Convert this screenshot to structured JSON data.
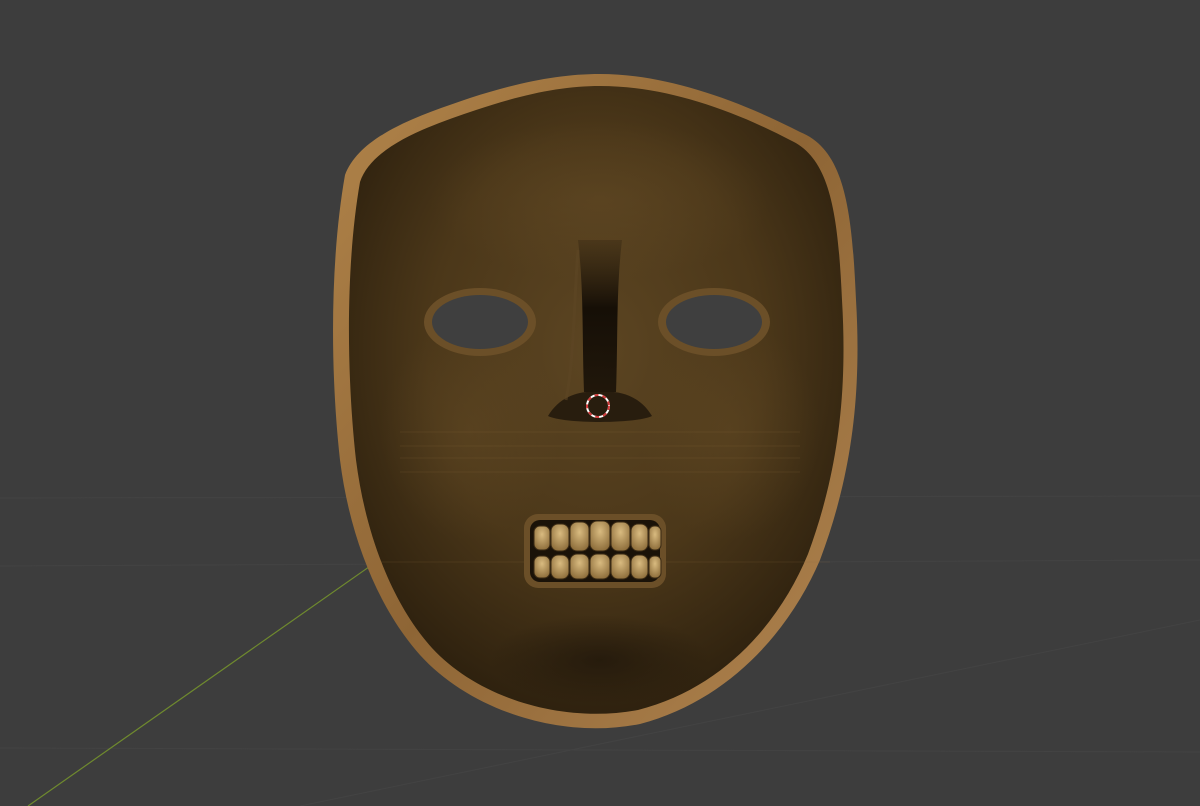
{
  "viewport": {
    "background_color": "#3d3d3d",
    "grid_line_color": "#4a4a4a",
    "x_axis_color": "#6f8a2e",
    "y_axis_color": "#6f8a2e"
  },
  "mask": {
    "base_color": "#4e3a1c",
    "rim_color": "#a57a44",
    "shadow_color": "#1d140a",
    "highlight_color": "#7a5a30",
    "teeth_color": "#c6a46a",
    "eye_hole_color": "#3f3f3f"
  },
  "cursor_3d": {
    "ring_primary": "#d23a3a",
    "ring_secondary": "#ffffff"
  }
}
